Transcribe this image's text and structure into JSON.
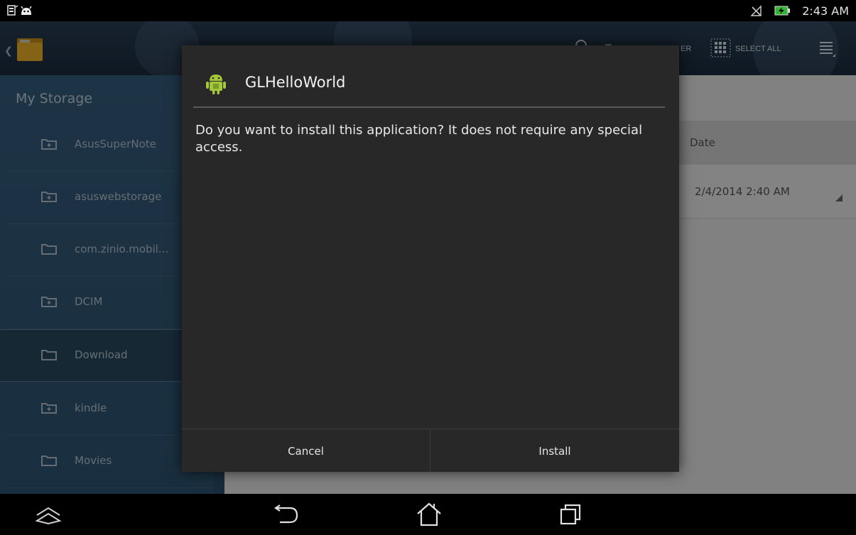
{
  "status_bar": {
    "time": "2:43 AM",
    "left_icons": [
      "sim-icon",
      "android-debug-icon"
    ],
    "right_icons": [
      "no-signal-icon",
      "battery-charging-icon"
    ]
  },
  "action_bar": {
    "partial_label": "ER",
    "select_all_label": "SELECT ALL",
    "icons": [
      "back-chevron-icon",
      "file-manager-folder-icon",
      "search-icon",
      "folder-icon",
      "select-all-grid-icon",
      "menu-icon"
    ]
  },
  "sidebar": {
    "title": "My Storage",
    "items": [
      {
        "label": "AsusSuperNote",
        "icon": "folder-plus-icon"
      },
      {
        "label": "asuswebstorage",
        "icon": "folder-plus-icon"
      },
      {
        "label": "com.zinio.mobil...",
        "icon": "folder-icon"
      },
      {
        "label": "DCIM",
        "icon": "folder-plus-icon"
      },
      {
        "label": "Download",
        "icon": "folder-icon",
        "selected": true
      },
      {
        "label": "kindle",
        "icon": "folder-plus-icon"
      },
      {
        "label": "Movies",
        "icon": "folder-icon"
      }
    ]
  },
  "content": {
    "column_header": "Date",
    "rows": [
      {
        "date": "2/4/2014 2:40 AM"
      }
    ]
  },
  "dialog": {
    "title": "GLHelloWorld",
    "icon": "android-app-icon",
    "message": "Do you want to install this application? It does not require any special access.",
    "cancel_label": "Cancel",
    "install_label": "Install"
  },
  "nav_bar": {
    "icons": [
      "quick-settings-icon",
      "back-icon",
      "home-icon",
      "recent-apps-icon"
    ]
  },
  "colors": {
    "action_bar": "#1f3347",
    "sidebar": "#335a79",
    "dialog": "#282828",
    "android_green": "#a4c639"
  }
}
